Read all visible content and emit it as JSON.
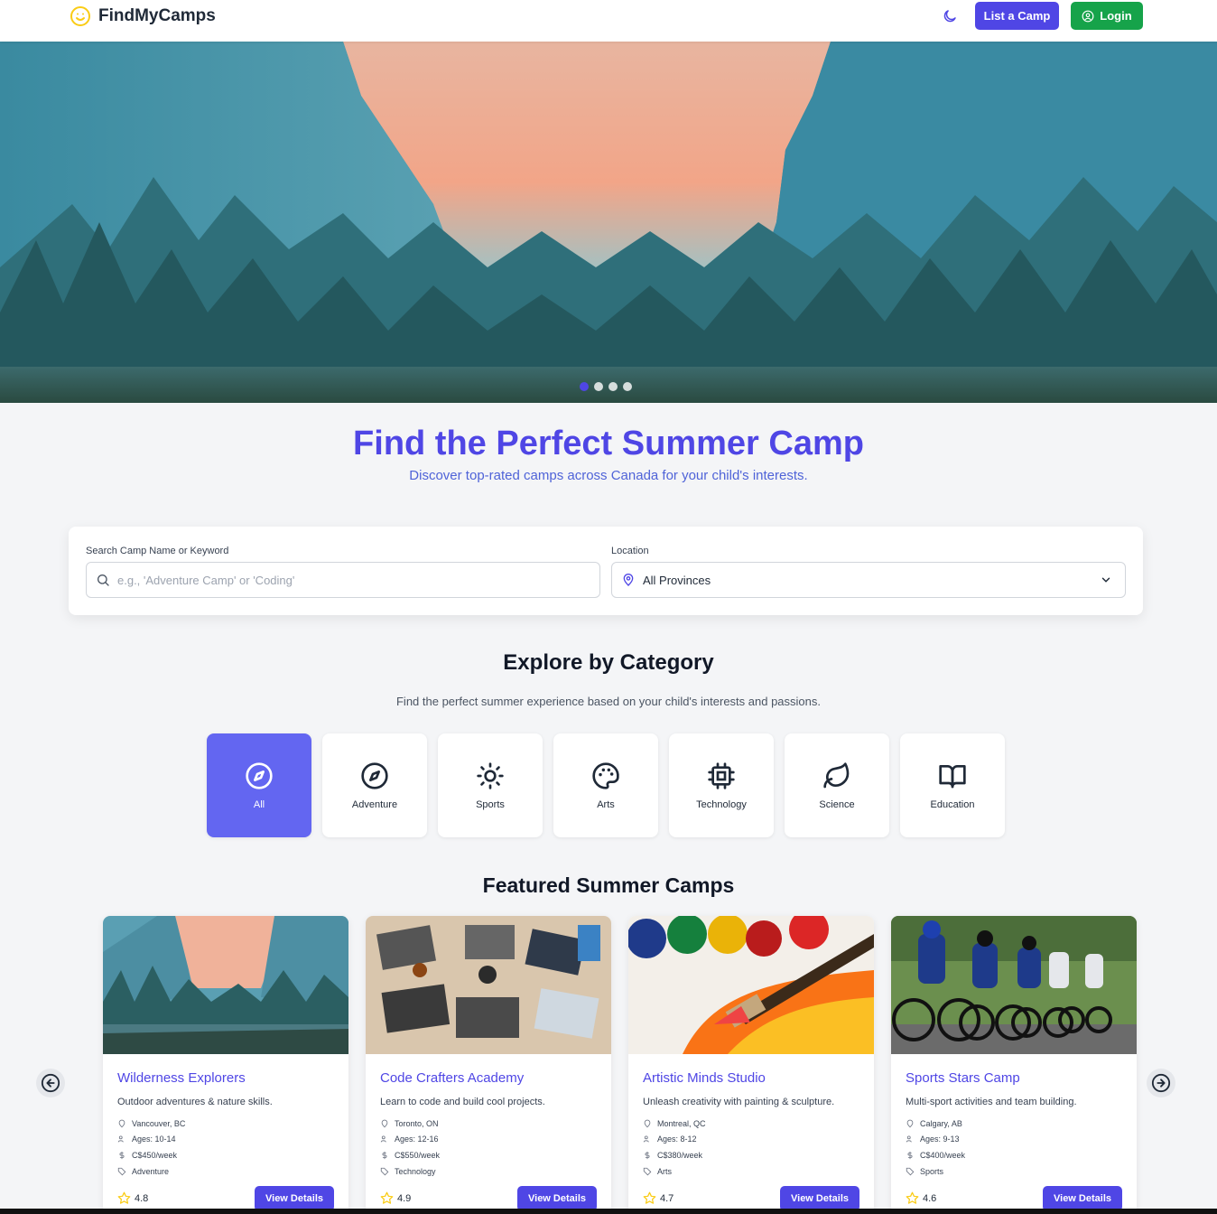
{
  "header": {
    "brand": "FindMyCamps",
    "list_button": "List a Camp",
    "login_button": "Login"
  },
  "hero": {
    "slides": 4,
    "active_slide": 1
  },
  "intro": {
    "title": "Find the Perfect Summer Camp",
    "subtitle": "Discover top-rated camps across Canada for your child's interests."
  },
  "search": {
    "keyword_label": "Search Camp Name or Keyword",
    "keyword_placeholder": "e.g., 'Adventure Camp' or 'Coding'",
    "location_label": "Location",
    "location_value": "All Provinces"
  },
  "categories": {
    "title": "Explore by Category",
    "subtitle": "Find the perfect summer experience based on your child's interests and passions.",
    "items": [
      {
        "label": "All",
        "icon": "compass-icon",
        "active": true
      },
      {
        "label": "Adventure",
        "icon": "compass-icon",
        "active": false
      },
      {
        "label": "Sports",
        "icon": "sun-icon",
        "active": false
      },
      {
        "label": "Arts",
        "icon": "palette-icon",
        "active": false
      },
      {
        "label": "Technology",
        "icon": "cpu-icon",
        "active": false
      },
      {
        "label": "Science",
        "icon": "leaf-icon",
        "active": false
      },
      {
        "label": "Education",
        "icon": "book-icon",
        "active": false
      }
    ]
  },
  "featured": {
    "title": "Featured Summer Camps",
    "view_label": "View Details",
    "camps": [
      {
        "name": "Wilderness Explorers",
        "description": "Outdoor adventures & nature skills.",
        "location": "Vancouver, BC",
        "ages": "Ages: 10-14",
        "price": "C$450/week",
        "category": "Adventure",
        "rating": "4.8"
      },
      {
        "name": "Code Crafters Academy",
        "description": "Learn to code and build cool projects.",
        "location": "Toronto, ON",
        "ages": "Ages: 12-16",
        "price": "C$550/week",
        "category": "Technology",
        "rating": "4.9"
      },
      {
        "name": "Artistic Minds Studio",
        "description": "Unleash creativity with painting & sculpture.",
        "location": "Montreal, QC",
        "ages": "Ages: 8-12",
        "price": "C$380/week",
        "category": "Arts",
        "rating": "4.7"
      },
      {
        "name": "Sports Stars Camp",
        "description": "Multi-sport activities and team building.",
        "location": "Calgary, AB",
        "ages": "Ages: 9-13",
        "price": "C$400/week",
        "category": "Sports",
        "rating": "4.6"
      }
    ]
  },
  "colors": {
    "primary": "#4f46e5",
    "category_active": "#6366f1",
    "login": "#16a34a",
    "star": "#facc15"
  }
}
